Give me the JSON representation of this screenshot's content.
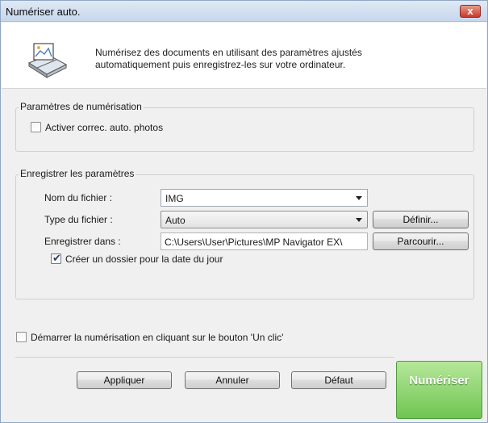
{
  "window": {
    "title": "Numériser auto.",
    "close_label": "x"
  },
  "header": {
    "description_line1": "Numérisez des documents en utilisant des paramètres ajustés",
    "description_line2": "automatiquement puis enregistrez-les sur votre ordinateur.",
    "icon": "scanner-icon"
  },
  "scan_settings": {
    "group_label": "Paramètres de numérisation",
    "auto_correct_label": "Activer correc. auto. photos",
    "auto_correct_checked": false
  },
  "save_settings": {
    "group_label": "Enregistrer les paramètres",
    "file_name_label": "Nom du fichier :",
    "file_name_value": "IMG",
    "file_type_label": "Type du fichier :",
    "file_type_value": "Auto",
    "define_button": "Définir...",
    "save_in_label": "Enregistrer dans :",
    "save_in_value": "C:\\Users\\User\\Pictures\\MP Navigator EX\\",
    "browse_button": "Parcourir...",
    "date_folder_label": "Créer un dossier pour la date du jour",
    "date_folder_checked": true
  },
  "one_click": {
    "label": "Démarrer la numérisation en cliquant sur le bouton 'Un clic'",
    "checked": false
  },
  "footer": {
    "apply_button": "Appliquer",
    "cancel_button": "Annuler",
    "default_button": "Défaut",
    "scan_button": "Numériser"
  },
  "colors": {
    "scan_button": "#6fc551",
    "title_bar": "#c7d7ec",
    "close_button": "#c8392c"
  }
}
